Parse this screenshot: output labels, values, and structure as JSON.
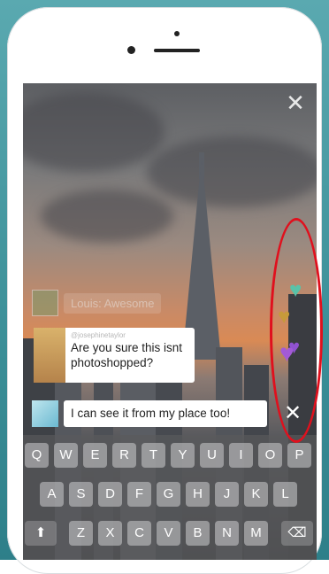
{
  "app": {
    "top_close_glyph": "✕",
    "hearts": [
      "heart-icon",
      "heart-icon",
      "heart-icon",
      "heart-icon"
    ],
    "heart_colors": [
      "#59c2a8",
      "#c79a3a",
      "#a35ad6",
      "#9052d0"
    ]
  },
  "comments": {
    "faded": {
      "text": "Louis: Awesome"
    },
    "main": {
      "user": "@josephinetaylor",
      "message": "Are you sure this isnt photoshopped?"
    }
  },
  "composer": {
    "value": "I can see it from my place too!",
    "close_glyph": "✕"
  },
  "keyboard": {
    "row1": [
      "Q",
      "W",
      "E",
      "R",
      "T",
      "Y",
      "U",
      "I",
      "O",
      "P"
    ],
    "row2": [
      "A",
      "S",
      "D",
      "F",
      "G",
      "H",
      "J",
      "K",
      "L"
    ],
    "row3": [
      "Z",
      "X",
      "C",
      "V",
      "B",
      "N",
      "M"
    ],
    "shift_glyph": "⬆",
    "delete_glyph": "⌫"
  },
  "annotation": {
    "color": "#e0101d"
  }
}
